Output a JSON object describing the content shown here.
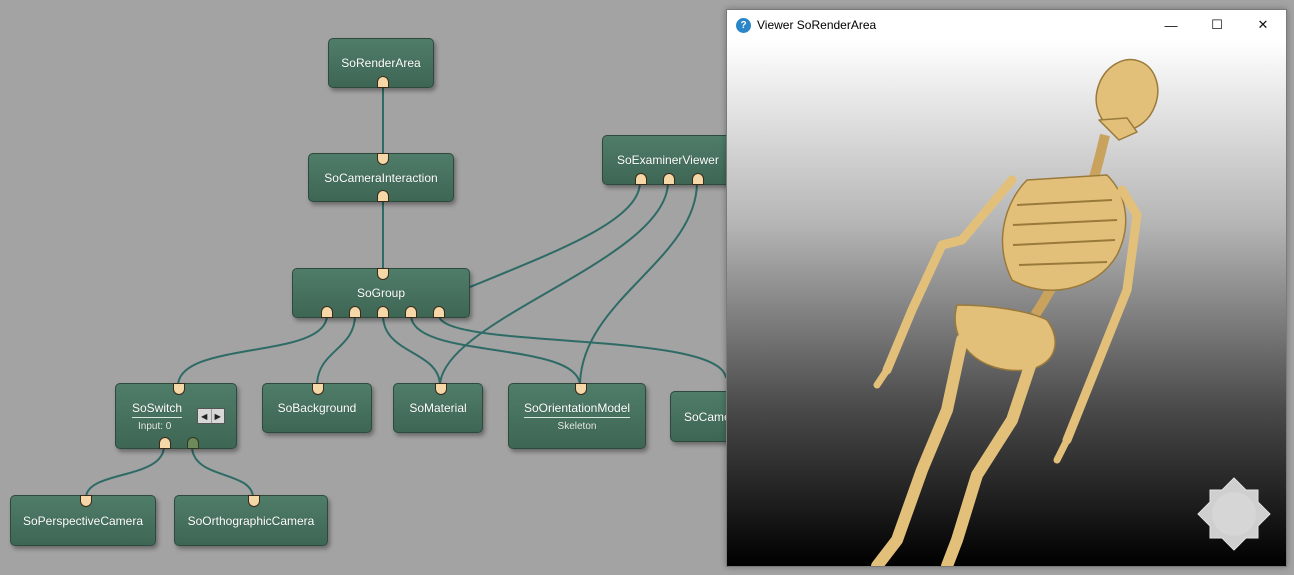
{
  "graph": {
    "nodes": {
      "render_area": "SoRenderArea",
      "camera_interaction": "SoCameraInteraction",
      "examiner_viewer": "SoExaminerViewer",
      "group": "SoGroup",
      "switch_title": "SoSwitch",
      "switch_input": "Input: 0",
      "background": "SoBackground",
      "material": "SoMaterial",
      "orientation_model_title": "SoOrientationModel",
      "orientation_model_sub": "Skeleton",
      "camera_partial": "SoCame",
      "perspective_camera": "SoPerspectiveCamera",
      "orthographic_camera": "SoOrthographicCamera"
    },
    "stepper": {
      "left": "◀",
      "right": "▶"
    }
  },
  "viewer": {
    "title": "Viewer SoRenderArea",
    "minimize": "—",
    "maximize": "☐",
    "close": "✕"
  },
  "colors": {
    "canvas": "#a3a3a3",
    "node": "#4a7763",
    "port": "#f5d7a8",
    "wire": "#2f6b66",
    "bone": "#e3c07a"
  }
}
